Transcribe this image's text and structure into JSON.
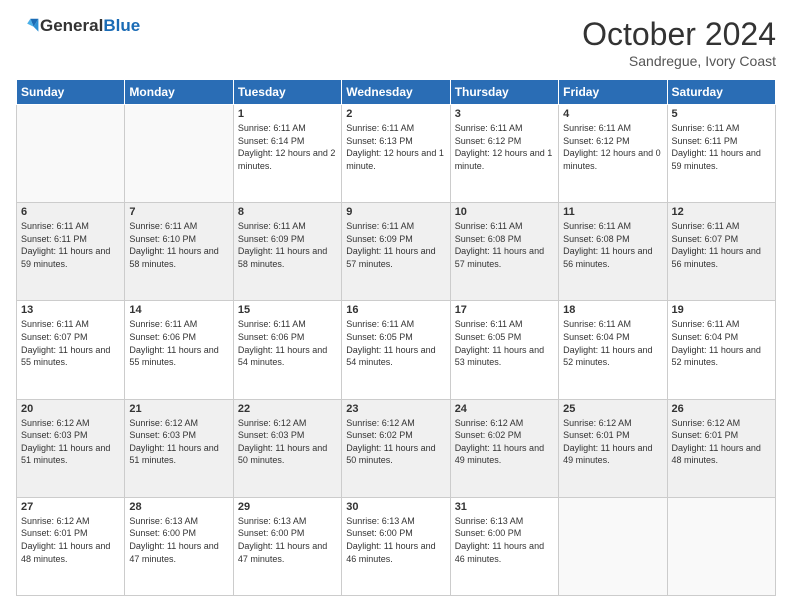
{
  "header": {
    "logo_general": "General",
    "logo_blue": "Blue",
    "month": "October 2024",
    "location": "Sandregue, Ivory Coast"
  },
  "weekdays": [
    "Sunday",
    "Monday",
    "Tuesday",
    "Wednesday",
    "Thursday",
    "Friday",
    "Saturday"
  ],
  "weeks": [
    {
      "shade": false,
      "days": [
        {
          "num": "",
          "empty": true
        },
        {
          "num": "",
          "empty": true
        },
        {
          "num": "1",
          "sunrise": "Sunrise: 6:11 AM",
          "sunset": "Sunset: 6:14 PM",
          "daylight": "Daylight: 12 hours and 2 minutes."
        },
        {
          "num": "2",
          "sunrise": "Sunrise: 6:11 AM",
          "sunset": "Sunset: 6:13 PM",
          "daylight": "Daylight: 12 hours and 1 minute."
        },
        {
          "num": "3",
          "sunrise": "Sunrise: 6:11 AM",
          "sunset": "Sunset: 6:12 PM",
          "daylight": "Daylight: 12 hours and 1 minute."
        },
        {
          "num": "4",
          "sunrise": "Sunrise: 6:11 AM",
          "sunset": "Sunset: 6:12 PM",
          "daylight": "Daylight: 12 hours and 0 minutes."
        },
        {
          "num": "5",
          "sunrise": "Sunrise: 6:11 AM",
          "sunset": "Sunset: 6:11 PM",
          "daylight": "Daylight: 11 hours and 59 minutes."
        }
      ]
    },
    {
      "shade": true,
      "days": [
        {
          "num": "6",
          "sunrise": "Sunrise: 6:11 AM",
          "sunset": "Sunset: 6:11 PM",
          "daylight": "Daylight: 11 hours and 59 minutes."
        },
        {
          "num": "7",
          "sunrise": "Sunrise: 6:11 AM",
          "sunset": "Sunset: 6:10 PM",
          "daylight": "Daylight: 11 hours and 58 minutes."
        },
        {
          "num": "8",
          "sunrise": "Sunrise: 6:11 AM",
          "sunset": "Sunset: 6:09 PM",
          "daylight": "Daylight: 11 hours and 58 minutes."
        },
        {
          "num": "9",
          "sunrise": "Sunrise: 6:11 AM",
          "sunset": "Sunset: 6:09 PM",
          "daylight": "Daylight: 11 hours and 57 minutes."
        },
        {
          "num": "10",
          "sunrise": "Sunrise: 6:11 AM",
          "sunset": "Sunset: 6:08 PM",
          "daylight": "Daylight: 11 hours and 57 minutes."
        },
        {
          "num": "11",
          "sunrise": "Sunrise: 6:11 AM",
          "sunset": "Sunset: 6:08 PM",
          "daylight": "Daylight: 11 hours and 56 minutes."
        },
        {
          "num": "12",
          "sunrise": "Sunrise: 6:11 AM",
          "sunset": "Sunset: 6:07 PM",
          "daylight": "Daylight: 11 hours and 56 minutes."
        }
      ]
    },
    {
      "shade": false,
      "days": [
        {
          "num": "13",
          "sunrise": "Sunrise: 6:11 AM",
          "sunset": "Sunset: 6:07 PM",
          "daylight": "Daylight: 11 hours and 55 minutes."
        },
        {
          "num": "14",
          "sunrise": "Sunrise: 6:11 AM",
          "sunset": "Sunset: 6:06 PM",
          "daylight": "Daylight: 11 hours and 55 minutes."
        },
        {
          "num": "15",
          "sunrise": "Sunrise: 6:11 AM",
          "sunset": "Sunset: 6:06 PM",
          "daylight": "Daylight: 11 hours and 54 minutes."
        },
        {
          "num": "16",
          "sunrise": "Sunrise: 6:11 AM",
          "sunset": "Sunset: 6:05 PM",
          "daylight": "Daylight: 11 hours and 54 minutes."
        },
        {
          "num": "17",
          "sunrise": "Sunrise: 6:11 AM",
          "sunset": "Sunset: 6:05 PM",
          "daylight": "Daylight: 11 hours and 53 minutes."
        },
        {
          "num": "18",
          "sunrise": "Sunrise: 6:11 AM",
          "sunset": "Sunset: 6:04 PM",
          "daylight": "Daylight: 11 hours and 52 minutes."
        },
        {
          "num": "19",
          "sunrise": "Sunrise: 6:11 AM",
          "sunset": "Sunset: 6:04 PM",
          "daylight": "Daylight: 11 hours and 52 minutes."
        }
      ]
    },
    {
      "shade": true,
      "days": [
        {
          "num": "20",
          "sunrise": "Sunrise: 6:12 AM",
          "sunset": "Sunset: 6:03 PM",
          "daylight": "Daylight: 11 hours and 51 minutes."
        },
        {
          "num": "21",
          "sunrise": "Sunrise: 6:12 AM",
          "sunset": "Sunset: 6:03 PM",
          "daylight": "Daylight: 11 hours and 51 minutes."
        },
        {
          "num": "22",
          "sunrise": "Sunrise: 6:12 AM",
          "sunset": "Sunset: 6:03 PM",
          "daylight": "Daylight: 11 hours and 50 minutes."
        },
        {
          "num": "23",
          "sunrise": "Sunrise: 6:12 AM",
          "sunset": "Sunset: 6:02 PM",
          "daylight": "Daylight: 11 hours and 50 minutes."
        },
        {
          "num": "24",
          "sunrise": "Sunrise: 6:12 AM",
          "sunset": "Sunset: 6:02 PM",
          "daylight": "Daylight: 11 hours and 49 minutes."
        },
        {
          "num": "25",
          "sunrise": "Sunrise: 6:12 AM",
          "sunset": "Sunset: 6:01 PM",
          "daylight": "Daylight: 11 hours and 49 minutes."
        },
        {
          "num": "26",
          "sunrise": "Sunrise: 6:12 AM",
          "sunset": "Sunset: 6:01 PM",
          "daylight": "Daylight: 11 hours and 48 minutes."
        }
      ]
    },
    {
      "shade": false,
      "days": [
        {
          "num": "27",
          "sunrise": "Sunrise: 6:12 AM",
          "sunset": "Sunset: 6:01 PM",
          "daylight": "Daylight: 11 hours and 48 minutes."
        },
        {
          "num": "28",
          "sunrise": "Sunrise: 6:13 AM",
          "sunset": "Sunset: 6:00 PM",
          "daylight": "Daylight: 11 hours and 47 minutes."
        },
        {
          "num": "29",
          "sunrise": "Sunrise: 6:13 AM",
          "sunset": "Sunset: 6:00 PM",
          "daylight": "Daylight: 11 hours and 47 minutes."
        },
        {
          "num": "30",
          "sunrise": "Sunrise: 6:13 AM",
          "sunset": "Sunset: 6:00 PM",
          "daylight": "Daylight: 11 hours and 46 minutes."
        },
        {
          "num": "31",
          "sunrise": "Sunrise: 6:13 AM",
          "sunset": "Sunset: 6:00 PM",
          "daylight": "Daylight: 11 hours and 46 minutes."
        },
        {
          "num": "",
          "empty": true
        },
        {
          "num": "",
          "empty": true
        }
      ]
    }
  ]
}
